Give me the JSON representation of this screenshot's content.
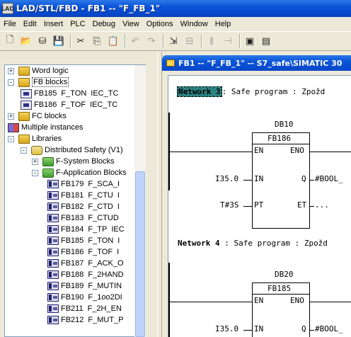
{
  "window": {
    "title": "LAD/STL/FBD  - FB1 -- \"F_FB_1\"",
    "app_icon": "simatic-app-icon"
  },
  "menu": [
    "File",
    "Edit",
    "Insert",
    "PLC",
    "Debug",
    "View",
    "Options",
    "Window",
    "Help"
  ],
  "toolbar_icons": [
    "new-icon",
    "open-icon",
    "online-icon",
    "save-icon",
    "cut-icon",
    "copy-icon",
    "paste-icon",
    "undo-icon",
    "redo-icon",
    "download-icon",
    "monitor-icon",
    "network-icon",
    "catalog-icon",
    "details-icon"
  ],
  "tree": {
    "items": [
      {
        "label": "Word logic",
        "icon": "book",
        "expander": "+",
        "level": 1
      },
      {
        "label": "FB blocks",
        "icon": "book",
        "expander": "-",
        "level": 1,
        "selected": true
      },
      {
        "label": "FB185",
        "col2": "F_TON",
        "col3": "IEC_TC",
        "icon": "fb",
        "level": 2
      },
      {
        "label": "FB186",
        "col2": "F_TOF",
        "col3": "IEC_TC",
        "icon": "fb",
        "level": 2
      },
      {
        "label": "FC blocks",
        "icon": "book",
        "expander": "+",
        "level": 1
      },
      {
        "label": "Multiple instances",
        "icon": "multi",
        "level": 1
      },
      {
        "label": "Libraries",
        "icon": "book",
        "expander": "-",
        "level": 1
      },
      {
        "label": "Distributed Safety (V1)",
        "icon": "lib",
        "expander": "-",
        "level": 2
      },
      {
        "label": "F-System Blocks",
        "icon": "folder",
        "expander": "+",
        "level": 3
      },
      {
        "label": "F-Application Blocks",
        "icon": "folder",
        "expander": "-",
        "level": 3
      },
      {
        "label": "FB179",
        "col2": "F_SCA_I",
        "icon": "blk",
        "level": 4
      },
      {
        "label": "FB181",
        "col2": "F_CTU",
        "col3": "I",
        "icon": "blk",
        "level": 4
      },
      {
        "label": "FB182",
        "col2": "F_CTD",
        "col3": "I",
        "icon": "blk",
        "level": 4
      },
      {
        "label": "FB183",
        "col2": "F_CTUD",
        "icon": "blk",
        "level": 4
      },
      {
        "label": "FB184",
        "col2": "F_TP",
        "col3": "IEC",
        "icon": "blk",
        "level": 4
      },
      {
        "label": "FB185",
        "col2": "F_TON",
        "col3": "I",
        "icon": "blk",
        "level": 4
      },
      {
        "label": "FB186",
        "col2": "F_TOF",
        "col3": "I",
        "icon": "blk",
        "level": 4
      },
      {
        "label": "FB187",
        "col2": "F_ACK_O",
        "icon": "blk",
        "level": 4
      },
      {
        "label": "FB188",
        "col2": "F_2HAND",
        "icon": "blk",
        "level": 4
      },
      {
        "label": "FB189",
        "col2": "F_MUTIN",
        "icon": "blk",
        "level": 4
      },
      {
        "label": "FB190",
        "col2": "F_1oo2DI",
        "icon": "blk",
        "level": 4
      },
      {
        "label": "FB211",
        "col2": "F_2H_EN",
        "icon": "blk",
        "level": 4
      },
      {
        "label": "FB212",
        "col2": "F_MUT_P",
        "icon": "blk",
        "level": 4
      }
    ]
  },
  "editor": {
    "title": "FB1 -- \"F_FB_1\" -- S7_safe\\SIMATIC 30",
    "networks": [
      {
        "label": "Network 3",
        "comment": ": Safe program : Zpožd",
        "db": "DB10",
        "block": "FB186",
        "pins_left": [
          "EN",
          "IN",
          "PT"
        ],
        "pins_right": [
          "ENO",
          "Q",
          "ET"
        ],
        "in_value": "I35.0",
        "pt_value": "T#3S",
        "q_value": "#BOOL_",
        "et_value": "..."
      },
      {
        "label": "Network 4",
        "comment": ": Safe program : Zpožd",
        "db": "DB20",
        "block": "FB185",
        "pins_left": [
          "EN",
          "IN"
        ],
        "pins_right": [
          "ENO",
          "Q"
        ],
        "in_value": "I35.0",
        "q_value": "#BOOL_"
      }
    ]
  }
}
